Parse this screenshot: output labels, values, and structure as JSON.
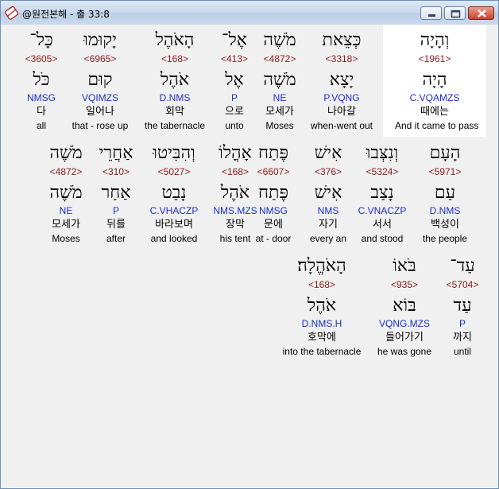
{
  "window": {
    "title": "@원전본해 - 출 33:8"
  },
  "icons": {
    "app": "bible-app-icon",
    "minimize": "minimize-icon",
    "maximize": "maximize-icon",
    "close": "close-icon"
  },
  "colors": {
    "strong_number": "#8b1a1a",
    "morphology": "#1a2ecc",
    "highlight": "#ffffff"
  },
  "lines": [
    {
      "words": [
        {
          "heb": "וְהָיָה",
          "num": "<1961>",
          "root": "הָיָה",
          "morph": "C.VQAMZS",
          "kor": "때에는",
          "eng": "And it came to pass",
          "selected": true
        },
        {
          "heb": "כְּצֵאת",
          "num": "<3318>",
          "root": "יָצָא",
          "morph": "P.VQNG",
          "kor": "나아갈",
          "eng": "when-went out"
        },
        {
          "heb": "מֹשֶׁה",
          "num": "<4872>",
          "root": "מֹשֶׁה",
          "morph": "NE",
          "kor": "모세가",
          "eng": "Moses"
        },
        {
          "heb": "אֶל־",
          "num": "<413>",
          "root": "אֶל",
          "morph": "P",
          "kor": "으로",
          "eng": "unto"
        },
        {
          "heb": "הָאֹהֶל",
          "num": "<168>",
          "root": "אֹהֶל",
          "morph": "D.NMS",
          "kor": "회막",
          "eng": "the tabernacle"
        },
        {
          "heb": "יָקוּמוּ",
          "num": "<6965>",
          "root": "קוּם",
          "morph": "VQIMZS",
          "kor": "일어나",
          "eng": "that - rose up"
        },
        {
          "heb": "כָּל־",
          "num": "<3605>",
          "root": "כֹּל",
          "morph": "NMSG",
          "kor": "다",
          "eng": "all"
        }
      ]
    },
    {
      "words": [
        {
          "heb": "הָעָם",
          "num": "<5971>",
          "root": "עַם",
          "morph": "D.NMS",
          "kor": "백성이",
          "eng": "the people"
        },
        {
          "heb": "וְנִצְּבוּ",
          "num": "<5324>",
          "root": "נָצַב",
          "morph": "C.VNACZP",
          "kor": "서서",
          "eng": "and stood"
        },
        {
          "heb": "אִישׁ",
          "num": "<376>",
          "root": "אִישׁ",
          "morph": "NMS",
          "kor": "자기",
          "eng": "every an"
        },
        {
          "heb": "פֶּתַח",
          "num": "<6607>",
          "root": "פֶּתַח",
          "morph": "NMSG",
          "kor": "문에",
          "eng": "at - door"
        },
        {
          "heb": "אָהֳלוֹ",
          "num": "<168>",
          "root": "אֹהֶל",
          "morph": "NMS.MZS",
          "kor": "장막",
          "eng": "his tent"
        },
        {
          "heb": "וְהִבִּיטוּ",
          "num": "<5027>",
          "root": "נָבַט",
          "morph": "C.VHACZP",
          "kor": "바라보며",
          "eng": "and looked"
        },
        {
          "heb": "אַחֲרֵי",
          "num": "<310>",
          "root": "אַחַר",
          "morph": "P",
          "kor": "뒤를",
          "eng": "after"
        },
        {
          "heb": "מֹשֶׁה",
          "num": "<4872>",
          "root": "מֹשֶׁה",
          "morph": "NE",
          "kor": "모세가",
          "eng": "Moses"
        }
      ]
    },
    {
      "words": [
        {
          "heb": "עַד־",
          "num": "<5704>",
          "root": "עַד",
          "morph": "P",
          "kor": "까지",
          "eng": "until"
        },
        {
          "heb": "בֹּאוֹ",
          "num": "<935>",
          "root": "בּוֹא",
          "morph": "VQNG.MZS",
          "kor": "들어가기",
          "eng": "he was gone"
        },
        {
          "heb": "הָאֹהֱלָה׃",
          "num": "<168>",
          "root": "אֹהֶל",
          "morph": "D.NMS.H",
          "kor": "호막에",
          "eng": "into the tabernacle"
        }
      ]
    }
  ]
}
